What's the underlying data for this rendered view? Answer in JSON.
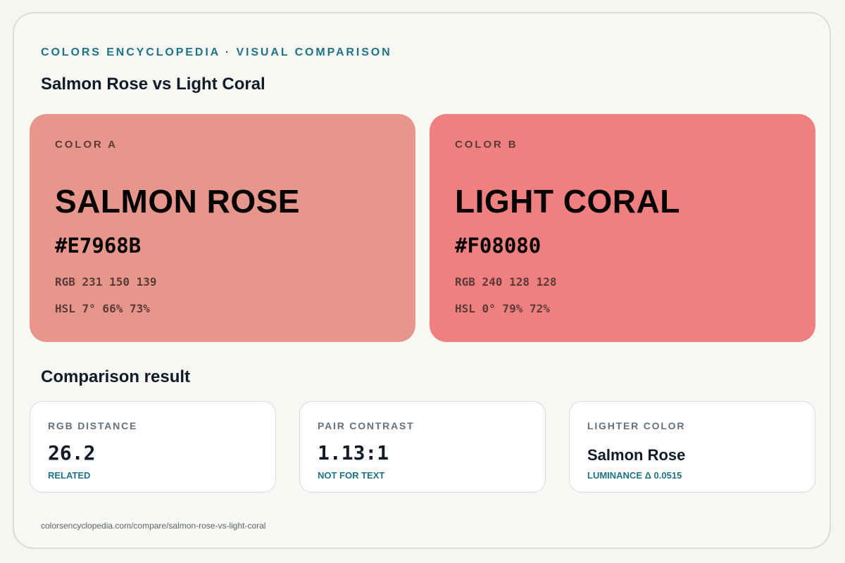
{
  "header": {
    "eyebrow": "COLORS ENCYCLOPEDIA · VISUAL COMPARISON",
    "title": "Salmon Rose vs Light Coral"
  },
  "colors": [
    {
      "slot": "COLOR A",
      "name": "SALMON ROSE",
      "hex": "#E7968B",
      "rgb": "RGB 231 150 139",
      "hsl": "HSL 7° 66% 73%",
      "swatch_color": "#E7968B"
    },
    {
      "slot": "COLOR B",
      "name": "LIGHT CORAL",
      "hex": "#F08080",
      "rgb": "RGB 240 128 128",
      "hsl": "HSL 0° 79% 72%",
      "swatch_color": "#F08080"
    }
  ],
  "comparison": {
    "title": "Comparison result",
    "cards": [
      {
        "label": "RGB DISTANCE",
        "value": "26.2",
        "note": "RELATED"
      },
      {
        "label": "PAIR CONTRAST",
        "value": "1.13:1",
        "note": "NOT FOR TEXT"
      },
      {
        "label": "LIGHTER COLOR",
        "value": "Salmon Rose",
        "note": "LUMINANCE Δ 0.0515"
      }
    ]
  },
  "footer": {
    "url": "colorsencyclopedia.com/compare/salmon-rose-vs-light-coral"
  },
  "theme": {
    "accent": "#1F7387",
    "page_background": "#F7F7F3",
    "card_background": "#FFFFFF"
  }
}
